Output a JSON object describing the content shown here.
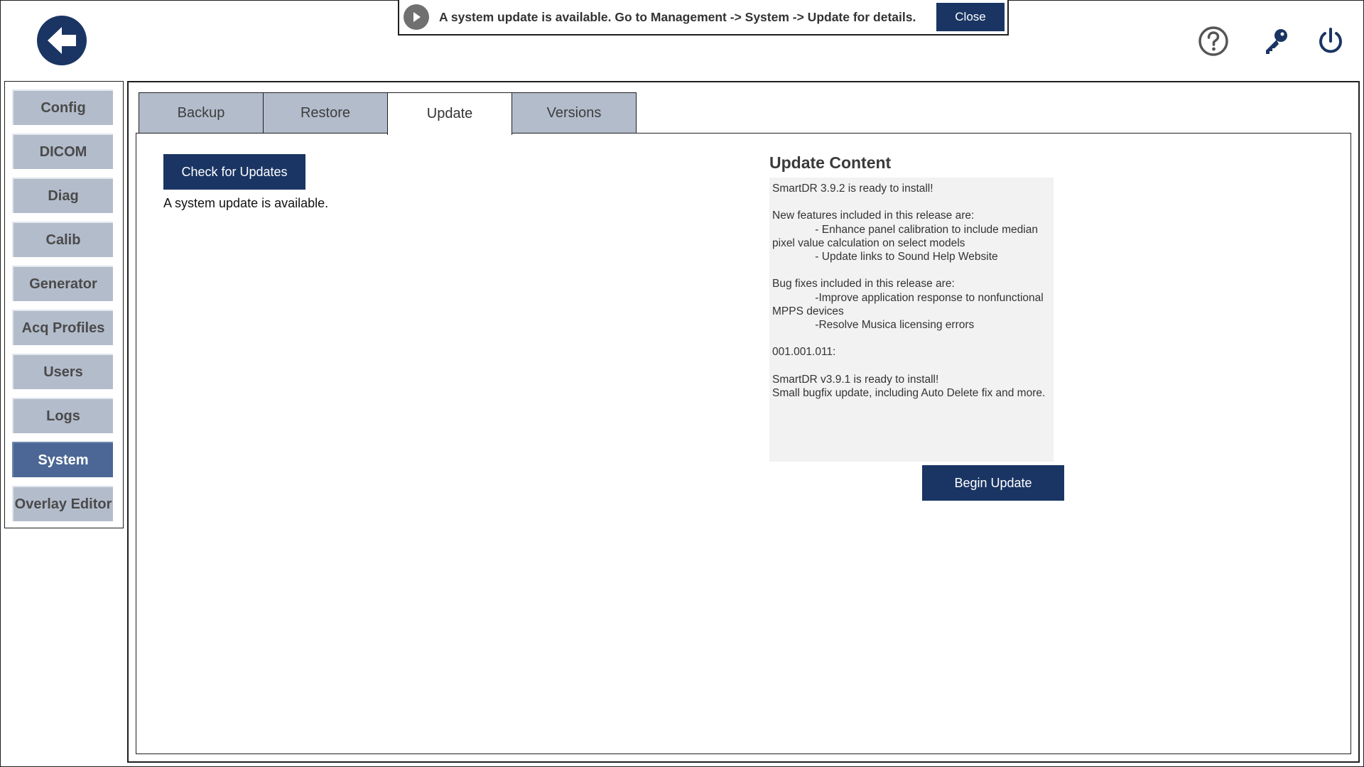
{
  "banner": {
    "message": "A system update is available. Go to Management -> System -> Update for details.",
    "close_label": "Close"
  },
  "icons": {
    "back": "back-arrow-icon",
    "play": "play-icon",
    "help": "help-icon",
    "key": "key-icon",
    "power": "power-icon"
  },
  "sidebar": {
    "items": [
      {
        "label": "Config",
        "active": false
      },
      {
        "label": "DICOM",
        "active": false
      },
      {
        "label": "Diag",
        "active": false
      },
      {
        "label": "Calib",
        "active": false
      },
      {
        "label": "Generator",
        "active": false
      },
      {
        "label": "Acq Profiles",
        "active": false
      },
      {
        "label": "Users",
        "active": false
      },
      {
        "label": "Logs",
        "active": false
      },
      {
        "label": "System",
        "active": true
      },
      {
        "label": "Overlay Editor",
        "active": false
      }
    ]
  },
  "tabs": [
    {
      "label": "Backup",
      "active": false
    },
    {
      "label": "Restore",
      "active": false
    },
    {
      "label": "Update",
      "active": true
    },
    {
      "label": "Versions",
      "active": false
    }
  ],
  "update": {
    "check_button_label": "Check for Updates",
    "status": "A system update is available.",
    "content_title": "Update Content",
    "content_text": "SmartDR 3.9.2 is ready to install!\n\nNew features included in this release are:\n              - Enhance panel calibration to include median pixel value calculation on select models\n              - Update links to Sound Help Website\n\nBug fixes included in this release are:\n              -Improve application response to nonfunctional MPPS devices\n              -Resolve Musica licensing errors\n\n001.001.011:\n\nSmartDR v3.9.1 is ready to install!\nSmall bugfix update, including Auto Delete fix and more.",
    "begin_button_label": "Begin Update"
  },
  "colors": {
    "accent": "#1a3563",
    "sidebar_item": "#b3bccb",
    "sidebar_active": "#4c6795",
    "content_bg": "#f2f2f2"
  }
}
